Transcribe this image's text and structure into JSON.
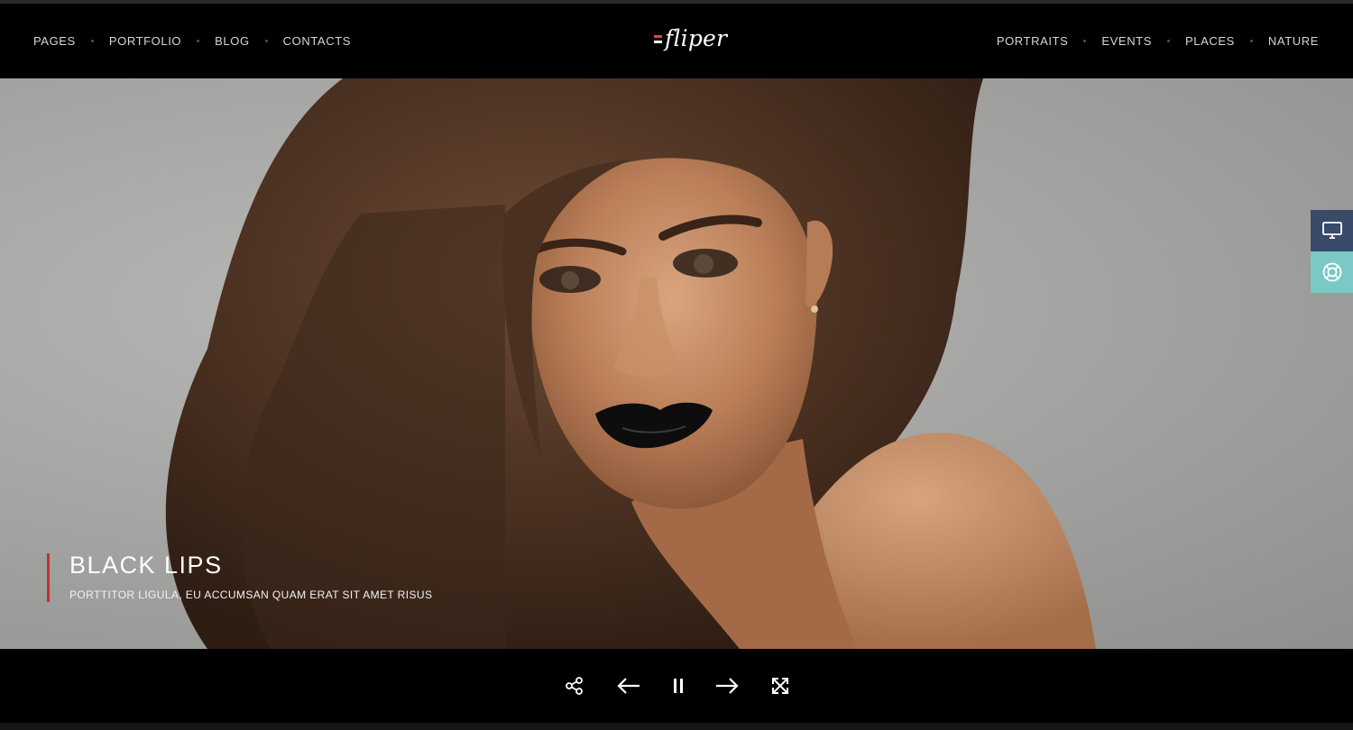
{
  "header": {
    "logo_text": "fliper",
    "nav_left": [
      "PAGES",
      "PORTFOLIO",
      "BLOG",
      "CONTACTS"
    ],
    "nav_right": [
      "PORTRAITS",
      "EVENTS",
      "PLACES",
      "NATURE"
    ]
  },
  "slide": {
    "title": "BLACK LIPS",
    "subtitle": "PORTTITOR LIGULA, EU ACCUMSAN QUAM ERAT SIT AMET RISUS"
  },
  "side_panel": {
    "icons": [
      "monitor-icon",
      "lifebuoy-icon"
    ]
  },
  "controls": {
    "icons": [
      "share-icon",
      "arrow-left-icon",
      "pause-icon",
      "arrow-right-icon",
      "fullscreen-icon"
    ]
  },
  "colors": {
    "accent_red": "#c9302c",
    "side_dark": "#3a4a6b",
    "side_teal": "#7ac9c7",
    "background": "#000000"
  }
}
